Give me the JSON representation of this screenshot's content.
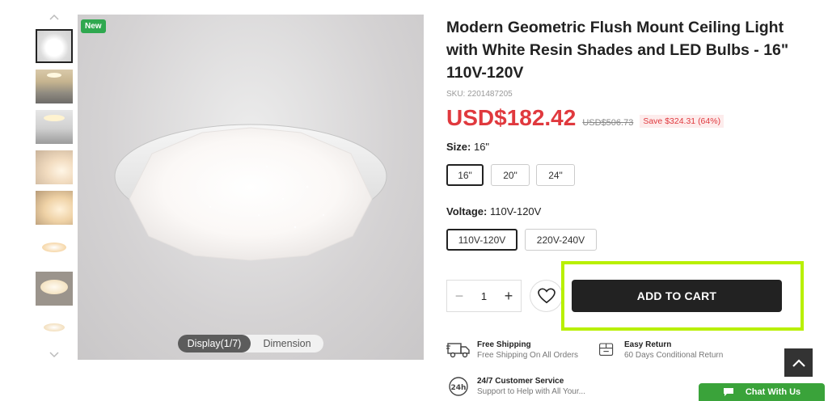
{
  "gallery": {
    "badge": "New",
    "toggle": {
      "display": "Display(1/7)",
      "dimension": "Dimension"
    },
    "thumbnails": [
      {
        "name": "thumb-1"
      },
      {
        "name": "thumb-2"
      },
      {
        "name": "thumb-3"
      },
      {
        "name": "thumb-4"
      },
      {
        "name": "thumb-5"
      },
      {
        "name": "thumb-6"
      },
      {
        "name": "thumb-7"
      },
      {
        "name": "thumb-8"
      }
    ]
  },
  "product": {
    "title": "Modern Geometric Flush Mount Ceiling Light with White Resin Shades and LED Bulbs - 16\" 110V-120V",
    "sku": "SKU: 2201487205",
    "price": "USD$182.42",
    "original_price": "USD$506.73",
    "save": "Save $324.31 (64%)"
  },
  "size": {
    "label": "Size:",
    "value": "16\"",
    "options": [
      "16\"",
      "20\"",
      "24\""
    ],
    "selected": "16\""
  },
  "voltage": {
    "label": "Voltage:",
    "value": "110V-120V",
    "options": [
      "110V-120V",
      "220V-240V"
    ],
    "selected": "110V-120V"
  },
  "purchase": {
    "quantity": "1",
    "minus": "−",
    "plus": "+",
    "add_to_cart": "ADD TO CART"
  },
  "features": [
    {
      "title": "Free Shipping",
      "sub": "Free Shipping On All Orders",
      "icon": "truck-icon"
    },
    {
      "title": "Easy Return",
      "sub": "60 Days Conditional Return",
      "icon": "return-box-icon"
    },
    {
      "title": "24/7 Customer Service",
      "sub": "Support to Help with All Your...",
      "icon": "24h-service-icon"
    }
  ],
  "chat": {
    "label": "Chat With Us"
  },
  "colors": {
    "price_red": "#e0393e",
    "new_badge": "#2fa84f",
    "highlight": "#b8f000",
    "chat_green": "#3aa33a"
  }
}
